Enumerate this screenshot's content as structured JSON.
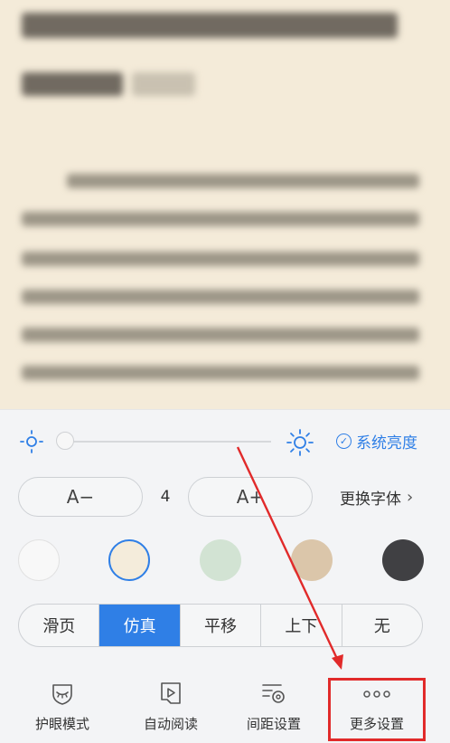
{
  "brightness": {
    "level": 0.0,
    "system_label": "系统亮度",
    "low_icon": "sun-dim-icon",
    "high_icon": "sun-bright-icon"
  },
  "font": {
    "decrease_label": "A−",
    "size_value": "4",
    "increase_label": "A+",
    "change_font_label": "更换字体",
    "chevron": "›"
  },
  "backgrounds": [
    {
      "name": "white",
      "color": "#f8f8f8",
      "selected": false
    },
    {
      "name": "beige",
      "color": "#f4ecdb",
      "selected": true
    },
    {
      "name": "green",
      "color": "#d2e3d3",
      "selected": false
    },
    {
      "name": "tan",
      "color": "#dbc6aa",
      "selected": false
    },
    {
      "name": "dark",
      "color": "#404043",
      "selected": false
    }
  ],
  "page_turn": {
    "modes": [
      "滑页",
      "仿真",
      "平移",
      "上下",
      "无"
    ],
    "active_index": 1
  },
  "tools": [
    {
      "label": "护眼模式",
      "icon": "eye-shield-icon"
    },
    {
      "label": "自动阅读",
      "icon": "auto-play-book-icon"
    },
    {
      "label": "间距设置",
      "icon": "spacing-gear-icon"
    },
    {
      "label": "更多设置",
      "icon": "more-dots-icon"
    }
  ],
  "colors": {
    "accent": "#2f7fe6",
    "annotation": "#e12a2a"
  }
}
